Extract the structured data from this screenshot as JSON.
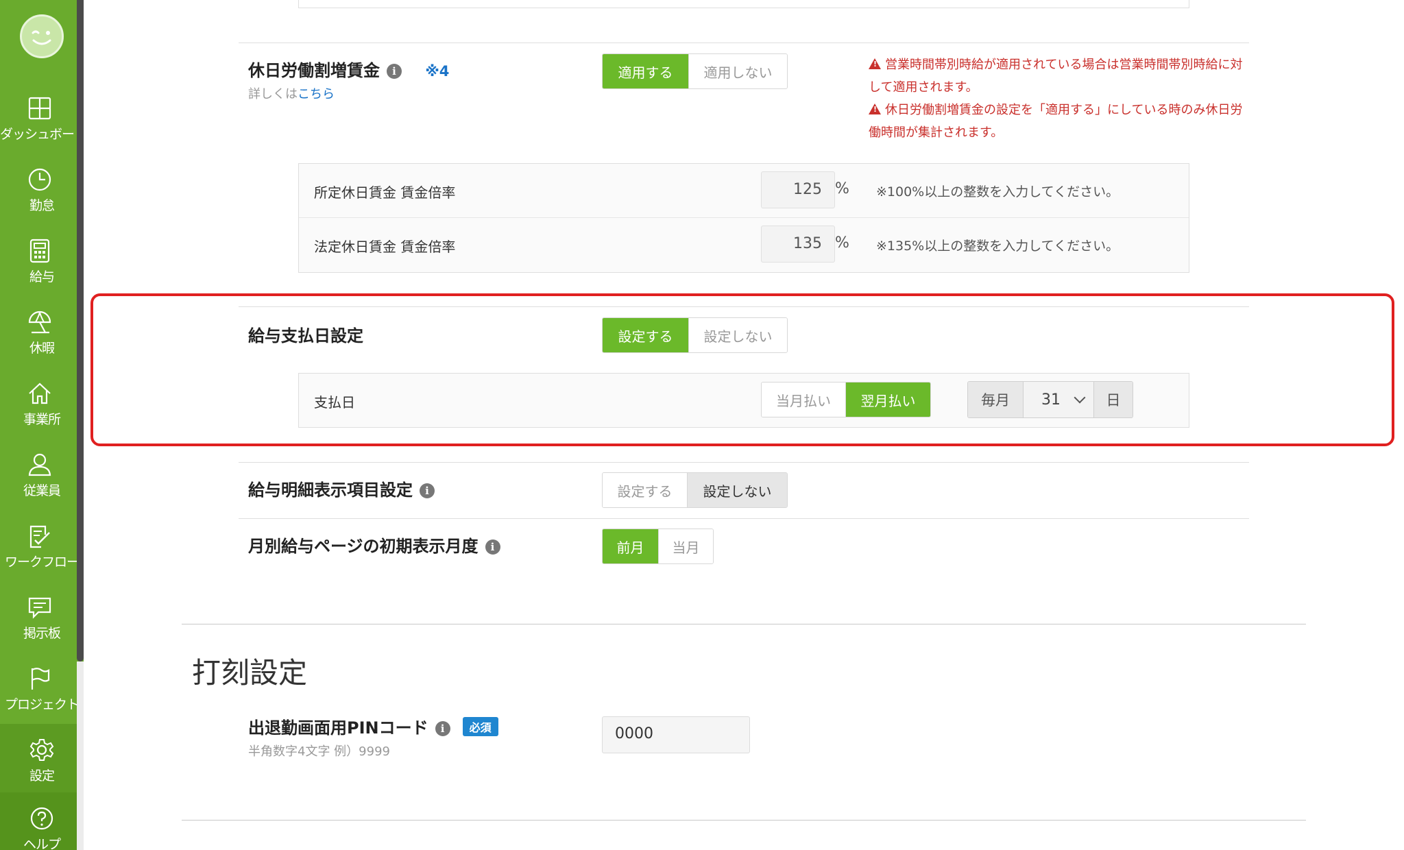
{
  "sidebar": {
    "items": [
      {
        "label": "ダッシュボード",
        "icon": "dashboard-icon"
      },
      {
        "label": "勤怠",
        "icon": "clock-icon"
      },
      {
        "label": "給与",
        "icon": "calculator-icon"
      },
      {
        "label": "休暇",
        "icon": "umbrella-icon"
      },
      {
        "label": "事業所",
        "icon": "home-icon"
      },
      {
        "label": "従業員",
        "icon": "person-icon"
      },
      {
        "label": "ワークフロー",
        "icon": "checklist-icon"
      },
      {
        "label": "掲示板",
        "icon": "chat-icon"
      },
      {
        "label": "プロジェクト",
        "icon": "flag-icon"
      },
      {
        "label": "設定",
        "icon": "gear-icon"
      },
      {
        "label": "ヘルプ",
        "icon": "help-icon"
      }
    ],
    "active": "設定"
  },
  "holiday_premium": {
    "title": "休日労働割増賃金",
    "note_ref": "※4",
    "details_prefix": "詳しくは",
    "details_link": "こちら",
    "options": [
      "適用する",
      "適用しない"
    ],
    "selected": "適用する",
    "warnings": [
      "営業時間帯別時給が適用されている場合は営業時間帯別時給に対して適用されます。",
      "休日労働割増賃金の設定を「適用する」にしている時のみ休日労働時間が集計されます。"
    ],
    "rows": [
      {
        "label": "所定休日賃金 賃金倍率",
        "value": "125",
        "unit": "%",
        "note": "※100%以上の整数を入力してください。"
      },
      {
        "label": "法定休日賃金 賃金倍率",
        "value": "135",
        "unit": "%",
        "note": "※135%以上の整数を入力してください。"
      }
    ]
  },
  "payday_setting": {
    "title": "給与支払日設定",
    "options": [
      "設定する",
      "設定しない"
    ],
    "selected": "設定する",
    "payday_label": "支払日",
    "pay_timing_options": [
      "当月払い",
      "翌月払い"
    ],
    "pay_timing_selected": "翌月払い",
    "prefix": "毎月",
    "day_value": "31",
    "suffix": "日"
  },
  "payslip_items": {
    "title": "給与明細表示項目設定",
    "options": [
      "設定する",
      "設定しない"
    ],
    "selected": "設定しない"
  },
  "monthly_page": {
    "title": "月別給与ページの初期表示月度",
    "options": [
      "前月",
      "当月"
    ],
    "selected": "前月"
  },
  "stamping": {
    "section_title": "打刻設定",
    "pin_label": "出退勤画面用PINコード",
    "required_badge": "必須",
    "pin_hint": "半角数字4文字 例）9999",
    "pin_value": "0000"
  },
  "colors": {
    "sidebar_green": "#6aab2d",
    "active_green": "#6bb92a",
    "warning_red": "#c9302c",
    "highlight_red": "#e02020",
    "link_blue": "#1a73c8",
    "badge_blue": "#1f86d0"
  }
}
